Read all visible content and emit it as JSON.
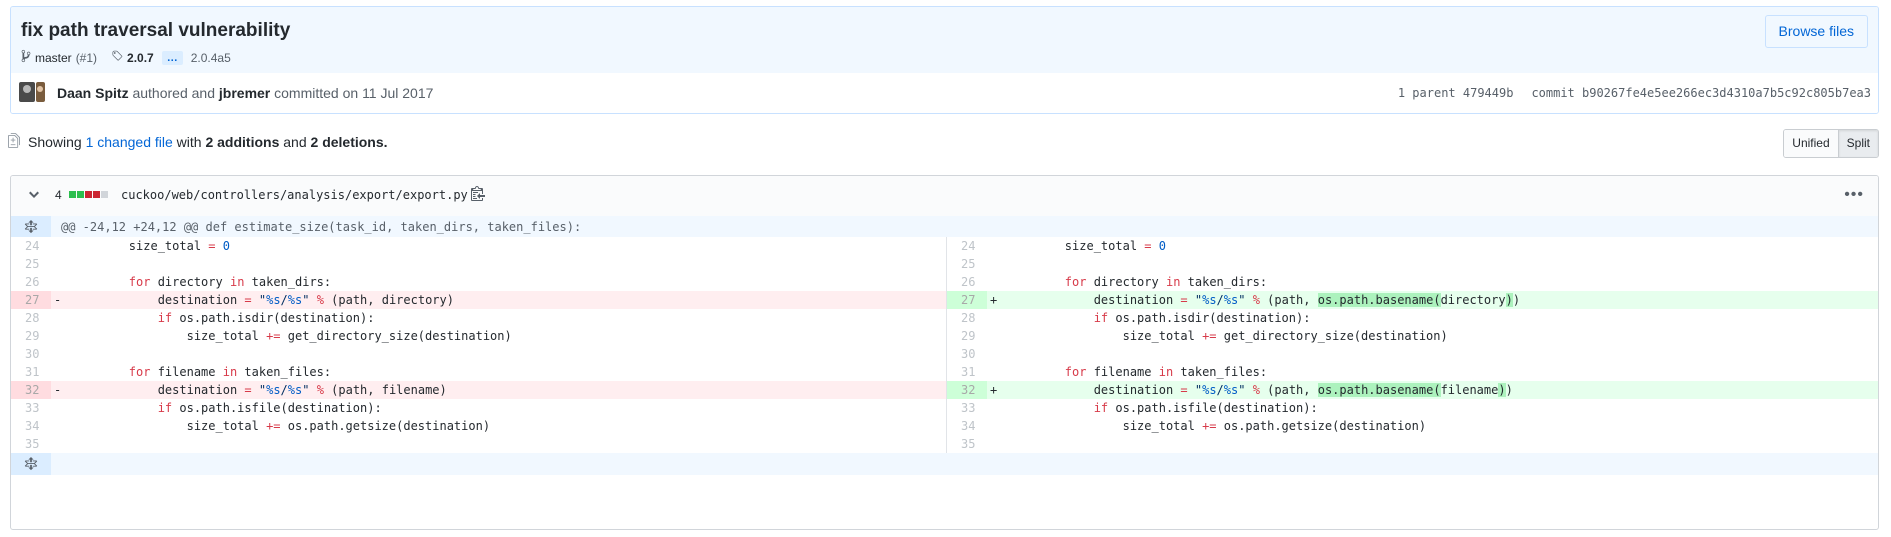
{
  "commit": {
    "title": "fix path traversal vulnerability",
    "branch": "master",
    "pr_ref": "(#1)",
    "tag": "2.0.7",
    "ellipsis": "…",
    "tag_other": "2.0.4a5",
    "browse_label": "Browse files",
    "author": "Daan Spitz",
    "authored_text": "authored and",
    "committer": "jbremer",
    "committed_text": "committed on 11 Jul 2017",
    "parent_text": "1 parent 479449b",
    "commit_text": "commit b90267fe4e5ee266ec3d4310a7b5c92c805b7ea3"
  },
  "toc": {
    "showing": "Showing",
    "changed_files": "1 changed file",
    "with": "with",
    "additions": "2 additions",
    "and": "and",
    "deletions": "2 deletions."
  },
  "view_toggle": {
    "unified": "Unified",
    "split": "Split",
    "selected": "Split"
  },
  "file": {
    "diffstat_count": "4",
    "diffstat_colors": [
      "#2cbe4e",
      "#2cbe4e",
      "#cb2431",
      "#cb2431",
      "#d1d5da"
    ],
    "path": "cuckoo/web/controllers/analysis/export/export.py",
    "hunk_header": "@@ -24,12 +24,12 @@ def estimate_size(task_id, taken_dirs, taken_files):"
  },
  "diff_lines": [
    {
      "l": "24",
      "r": "24",
      "type": "ctx",
      "left": "        size_total = 0",
      "right": "        size_total = 0"
    },
    {
      "l": "25",
      "r": "25",
      "type": "ctx",
      "left": "",
      "right": ""
    },
    {
      "l": "26",
      "r": "26",
      "type": "ctx",
      "left": "        for directory in taken_dirs:",
      "right": "        for directory in taken_dirs:"
    },
    {
      "l": "27",
      "r": "27",
      "type": "chg",
      "left": "            destination = \"%s/%s\" % (path, directory)",
      "right": "            destination = \"%s/%s\" % (path, os.path.basename(directory))"
    },
    {
      "l": "28",
      "r": "28",
      "type": "ctx",
      "left": "            if os.path.isdir(destination):",
      "right": "            if os.path.isdir(destination):"
    },
    {
      "l": "29",
      "r": "29",
      "type": "ctx",
      "left": "                size_total += get_directory_size(destination)",
      "right": "                size_total += get_directory_size(destination)"
    },
    {
      "l": "30",
      "r": "30",
      "type": "ctx",
      "left": "",
      "right": ""
    },
    {
      "l": "31",
      "r": "31",
      "type": "ctx",
      "left": "        for filename in taken_files:",
      "right": "        for filename in taken_files:"
    },
    {
      "l": "32",
      "r": "32",
      "type": "chg",
      "left": "            destination = \"%s/%s\" % (path, filename)",
      "right": "            destination = \"%s/%s\" % (path, os.path.basename(filename))"
    },
    {
      "l": "33",
      "r": "33",
      "type": "ctx",
      "left": "            if os.path.isfile(destination):",
      "right": "            if os.path.isfile(destination):"
    },
    {
      "l": "34",
      "r": "34",
      "type": "ctx",
      "left": "                size_total += os.path.getsize(destination)",
      "right": "                size_total += os.path.getsize(destination)"
    },
    {
      "l": "35",
      "r": "35",
      "type": "ctx",
      "left": "",
      "right": ""
    }
  ],
  "markers": {
    "del": "-",
    "add": "+"
  },
  "icons": {
    "branch": "git-branch-icon",
    "tag": "tag-icon",
    "file": "file-diff-icon",
    "chevron": "chevron-down-icon",
    "clipboard": "clipboard-icon",
    "kebab": "kebab-horizontal-icon",
    "expand": "unfold-icon"
  },
  "colors": {
    "accent": "#0366d6",
    "addition_bg": "#e6ffed",
    "deletion_bg": "#ffeef0",
    "highlight_add": "#acf2bd"
  }
}
